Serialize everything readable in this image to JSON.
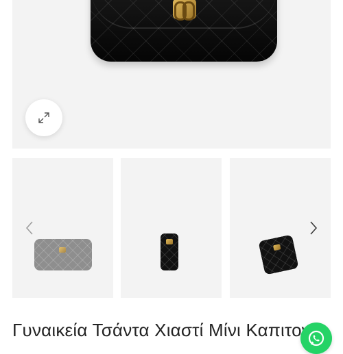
{
  "product": {
    "title": "Γυναικεία Τσάντα Χιαστί Μίνι Καπιτονέ"
  },
  "gallery": {
    "main_image_alt": "main product image",
    "thumbnails": [
      {
        "alt": "thumbnail 1"
      },
      {
        "alt": "thumbnail 2"
      },
      {
        "alt": "thumbnail 3"
      }
    ]
  },
  "icons": {
    "expand": "expand-icon",
    "prev": "chevron-left-icon",
    "next": "chevron-right-icon",
    "whatsapp": "whatsapp-icon"
  },
  "colors": {
    "image_bg": "#f3f3f3",
    "whatsapp_green": "#25d366",
    "title_text": "#242424"
  }
}
